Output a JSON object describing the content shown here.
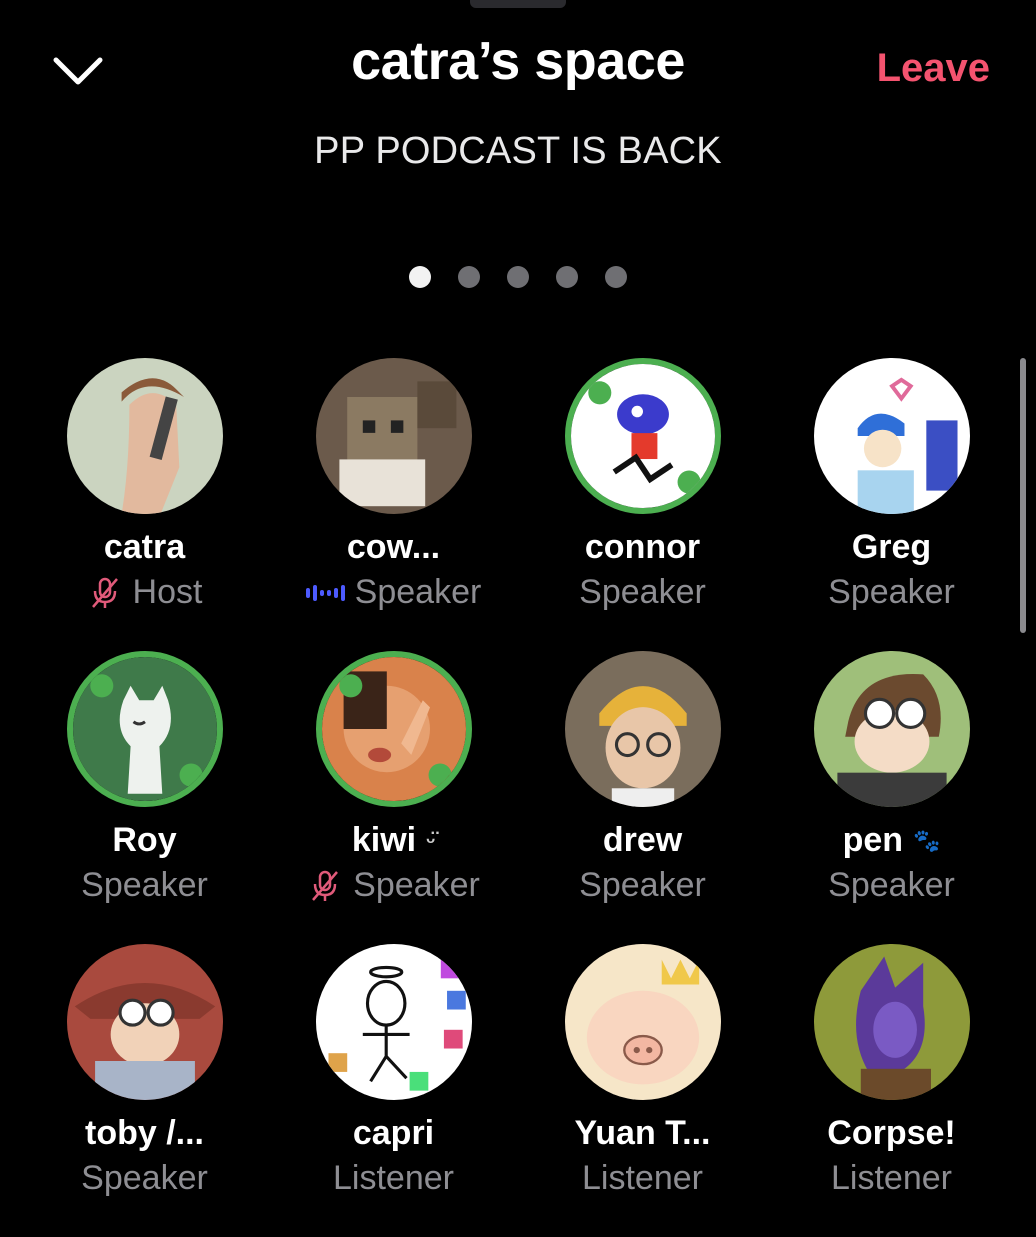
{
  "header": {
    "title": "catra’s space",
    "leave_label": "Leave",
    "subtitle": "PP PODCAST IS BACK"
  },
  "pager": {
    "count": 5,
    "active": 0
  },
  "colors": {
    "accent_leave": "#f4536f",
    "ring": "#4caf50",
    "muted_mic": "#e05a7a",
    "speaking_wave": "#4d5bff",
    "role_text": "#8e8e93"
  },
  "participants": [
    {
      "name": "catra",
      "role": "Host",
      "ring": false,
      "indicator": "muted-mic",
      "avatar_bg": "#cbd4c0"
    },
    {
      "name": "cow...",
      "role": "Speaker",
      "ring": false,
      "indicator": "speaking-wave",
      "avatar_bg": "#6b5a4b"
    },
    {
      "name": "connor",
      "role": "Speaker",
      "ring": true,
      "indicator": "",
      "avatar_bg": "#ffffff"
    },
    {
      "name": "Greg",
      "role": "Speaker",
      "ring": false,
      "indicator": "",
      "avatar_bg": "#ffffff"
    },
    {
      "name": "Roy",
      "role": "Speaker",
      "ring": true,
      "indicator": "",
      "avatar_bg": "#3f7a4a"
    },
    {
      "name": "kiwi",
      "name_suffix": "ᵕ̈",
      "role": "Speaker",
      "ring": true,
      "indicator": "muted-mic",
      "avatar_bg": "#d9824b"
    },
    {
      "name": "drew",
      "role": "Speaker",
      "ring": false,
      "indicator": "",
      "avatar_bg": "#7a6d5c"
    },
    {
      "name": "pen",
      "name_suffix": "🐾",
      "role": "Speaker",
      "ring": false,
      "indicator": "",
      "avatar_bg": "#9fbf7a"
    },
    {
      "name": "toby /...",
      "role": "Speaker",
      "ring": false,
      "indicator": "",
      "avatar_bg": "#a94a3e"
    },
    {
      "name": "capri",
      "role": "Listener",
      "ring": false,
      "indicator": "",
      "avatar_bg": "#ffffff"
    },
    {
      "name": "Yuan T...",
      "role": "Listener",
      "ring": false,
      "indicator": "",
      "avatar_bg": "#f6e6c8"
    },
    {
      "name": "Corpse!",
      "role": "Listener",
      "ring": false,
      "indicator": "",
      "avatar_bg": "#8e9a3a"
    }
  ]
}
